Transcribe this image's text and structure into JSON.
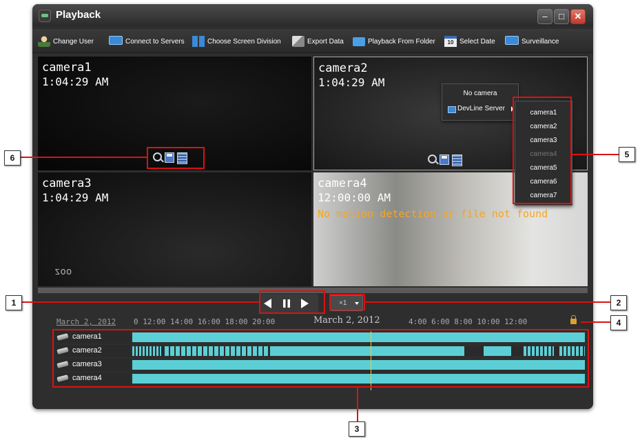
{
  "window": {
    "title": "Playback",
    "min_label": "–",
    "max_label": "□",
    "close_label": "✕"
  },
  "toolbar": [
    {
      "label": "Change User",
      "icon": "user-icon"
    },
    {
      "label": "Connect to Servers",
      "icon": "monitor-icon"
    },
    {
      "label": "Choose Screen Division",
      "icon": "grid-icon"
    },
    {
      "label": "Export Data",
      "icon": "export-icon"
    },
    {
      "label": "Playback From Folder",
      "icon": "folder-icon"
    },
    {
      "label": "Select Date",
      "icon": "calendar-icon",
      "icon_text": "10"
    },
    {
      "label": "Surveillance",
      "icon": "monitor-icon"
    }
  ],
  "panels": [
    {
      "name": "camera1",
      "time": "1:04:29 AM"
    },
    {
      "name": "camera2",
      "time": "1:04:29 AM"
    },
    {
      "name": "camera3",
      "time": "1:04:29 AM",
      "overlay": "zoo"
    },
    {
      "name": "camera4",
      "time": "12:00:00 AM",
      "message": "No motion detection or file not found"
    }
  ],
  "context_menu": {
    "no_camera": "No camera",
    "server": "DevLine Server"
  },
  "camera_submenu": [
    {
      "label": "camera1",
      "enabled": true
    },
    {
      "label": "camera2",
      "enabled": true
    },
    {
      "label": "camera3",
      "enabled": true
    },
    {
      "label": "camera4",
      "enabled": false
    },
    {
      "label": "camera5",
      "enabled": true
    },
    {
      "label": "camera6",
      "enabled": true
    },
    {
      "label": "camera7",
      "enabled": true
    }
  ],
  "playback": {
    "speed": "×1"
  },
  "timeline": {
    "date_link": "March 2, 2012",
    "ticks_left": "0  12:00  14:00  16:00  18:00  20:00",
    "center_date": "March 2, 2012",
    "ticks_right": "4:00   6:00   8:00   10:00  12:00",
    "rows": [
      "camera1",
      "camera2",
      "camera3",
      "camera4"
    ]
  },
  "callouts": [
    "1",
    "2",
    "3",
    "4",
    "5",
    "6"
  ],
  "colors": {
    "accent_red": "#d11111",
    "timeline_bar": "#5ccfd6",
    "message": "#f5a623",
    "cursor": "#e4d23a"
  }
}
